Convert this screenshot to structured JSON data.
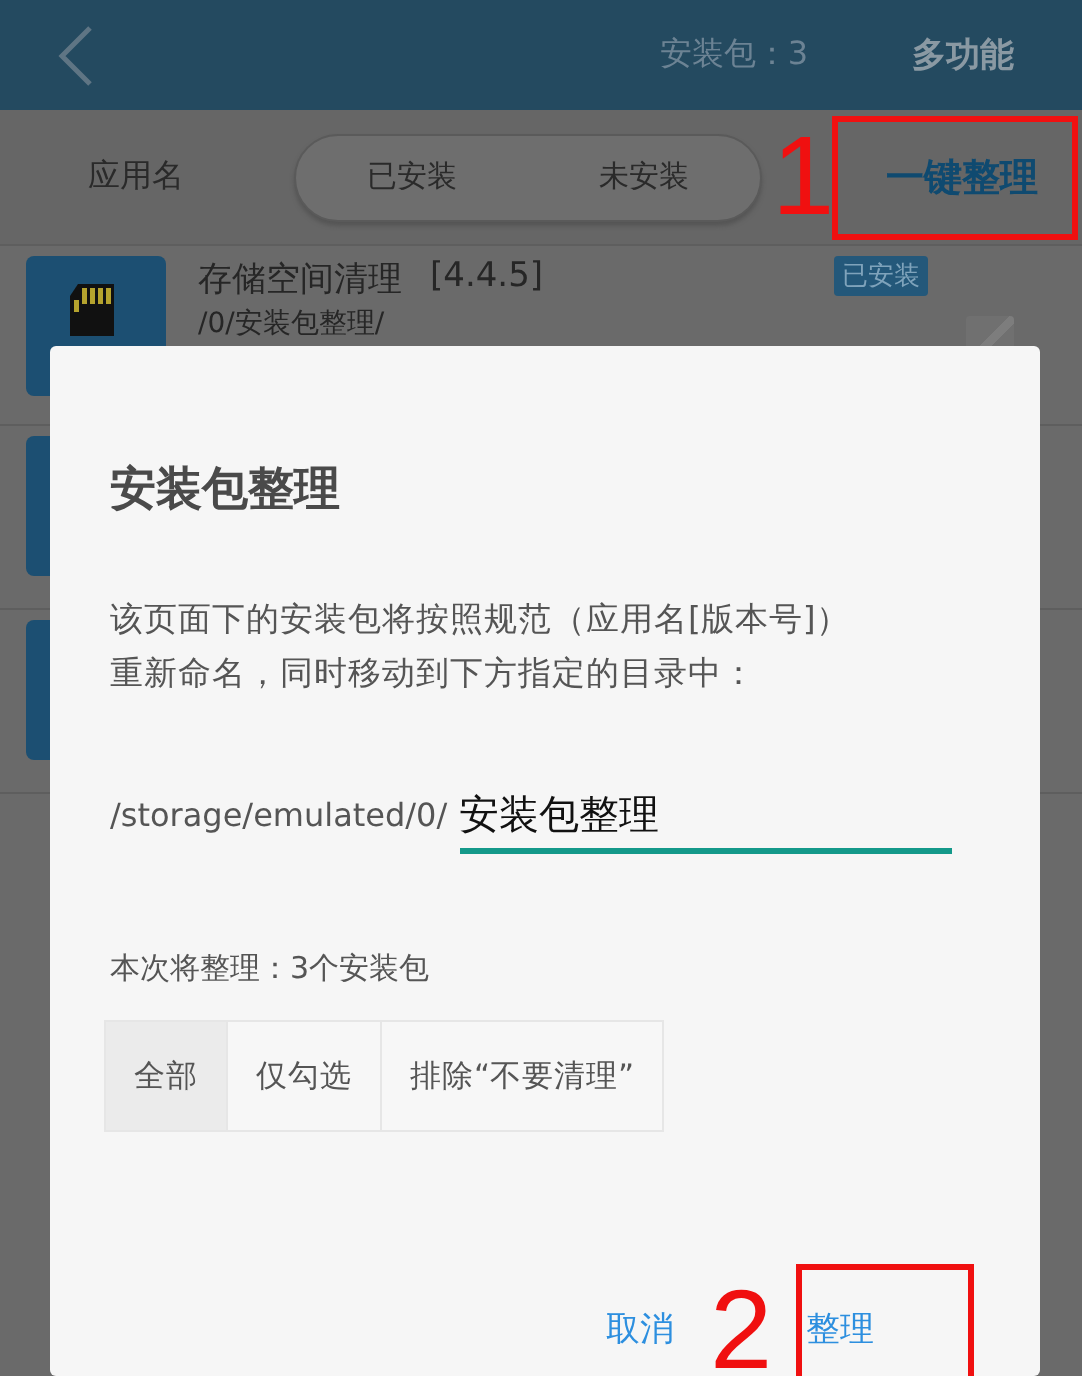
{
  "header": {
    "package_count": "安装包：3",
    "menu": "多功能"
  },
  "toolbar": {
    "column_label": "应用名",
    "filter_tabs": [
      {
        "label": "已安装",
        "selected": false
      },
      {
        "label": "未安装",
        "selected": false
      }
    ],
    "action": "一键整理"
  },
  "apps": [
    {
      "name": "存储空间清理",
      "version": "[4.4.5]",
      "path": "/0/安装包整理/",
      "status": "已安装",
      "checked": true
    }
  ],
  "dialog": {
    "title": "安装包整理",
    "message": "该页面下的安装包将按照规范（应用名[版本号]）重新命名，同时移动到下方指定的目录中：",
    "path_prefix": "/storage/emulated/0/",
    "folder_name": "安装包整理",
    "summary": "本次将整理：3个安装包",
    "scope_options": [
      {
        "label": "全部",
        "selected": true
      },
      {
        "label": "仅勾选",
        "selected": false
      },
      {
        "label": "排除“不要清理”",
        "selected": false
      }
    ],
    "buttons": [
      "取消",
      "整理"
    ]
  },
  "annotations": [
    {
      "label": "1"
    },
    {
      "label": "2"
    }
  ]
}
